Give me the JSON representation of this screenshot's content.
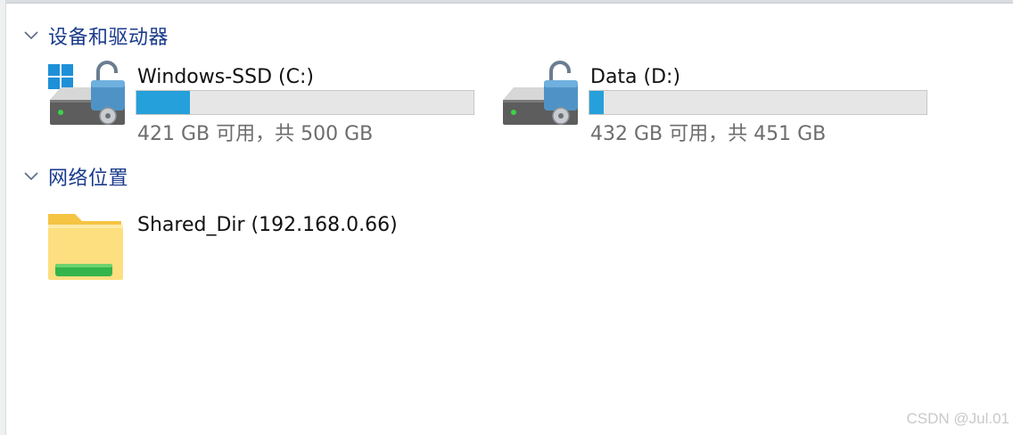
{
  "sections": {
    "devices": {
      "title": "设备和驱动器",
      "drives": [
        {
          "name": "Windows-SSD (C:)",
          "space_text": "421 GB 可用，共 500 GB",
          "used_fraction": 0.158,
          "icons": [
            "windows-logo-icon",
            "hard-drive-icon",
            "unlocked-padlock-icon"
          ]
        },
        {
          "name": "Data (D:)",
          "space_text": "432 GB 可用，共 451 GB",
          "used_fraction": 0.042,
          "icons": [
            "hard-drive-icon",
            "unlocked-padlock-icon"
          ]
        }
      ]
    },
    "network": {
      "title": "网络位置",
      "items": [
        {
          "name": "Shared_Dir (192.168.0.66)",
          "icon": "network-folder-icon"
        }
      ]
    }
  },
  "colors": {
    "group_title": "#1a3b8c",
    "usage_bar": "#26a0da",
    "usage_track": "#e6e6e6",
    "secondary_text": "#6d6d6d"
  },
  "watermark": "CSDN @Jul.01"
}
